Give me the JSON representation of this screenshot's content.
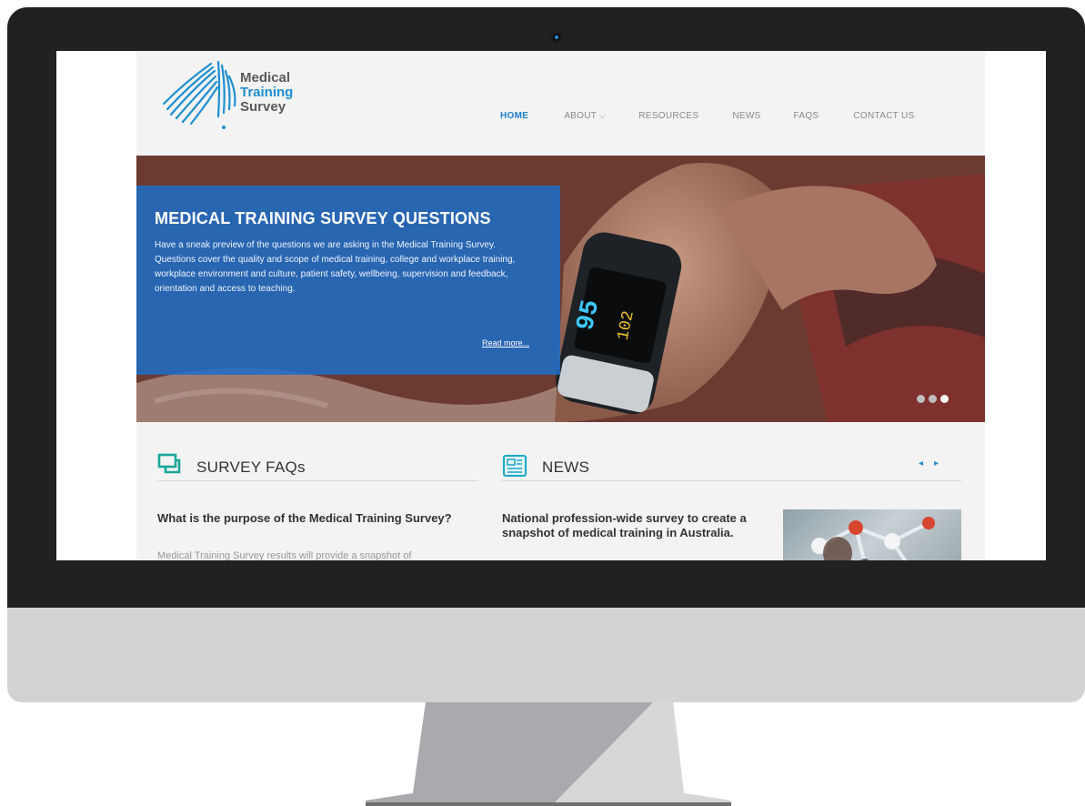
{
  "site": {
    "logo": {
      "line1": "Medical",
      "line2": "Training",
      "line3": "Survey"
    },
    "nav": [
      {
        "label": "HOME",
        "active": true
      },
      {
        "label": "ABOUT",
        "has_dropdown": true
      },
      {
        "label": "RESOURCES"
      },
      {
        "label": "NEWS"
      },
      {
        "label": "FAQS"
      },
      {
        "label": "CONTACT US"
      }
    ],
    "hero": {
      "title": "MEDICAL TRAINING SURVEY QUESTIONS",
      "body": "Have a sneak preview of the questions we are asking in the Medical Training Survey. Questions cover the quality and scope of medical training, college and workplace training, workplace environment and culture, patient safety, wellbeing, supervision and feedback, orientation and access to teaching.",
      "read_more": "Read more...",
      "slides": 3,
      "active_slide": 3,
      "oximeter_readout": {
        "spo2": "95",
        "pulse": "102"
      }
    },
    "faq": {
      "heading": "SURVEY FAQs",
      "question": "What is the purpose of the Medical Training Survey?",
      "answer_preview": "Medical Training Survey results will provide a snapshot of"
    },
    "news": {
      "heading": "NEWS",
      "headline": "National profession-wide survey to create a snapshot of medical training in Australia.",
      "prev_icon": "◂",
      "next_icon": "▸"
    },
    "colors": {
      "brand_blue": "#1e8fd1",
      "hero_box": "#1e6ec8",
      "teal_icon": "#1aa79a"
    }
  }
}
